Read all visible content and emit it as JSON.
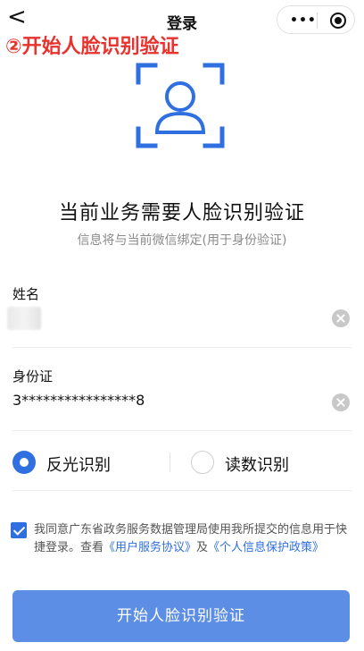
{
  "nav": {
    "back_glyph": "<",
    "title": "登录"
  },
  "annotation": "②开始人脸识别验证",
  "verify": {
    "headline": "当前业务需要人脸识别验证",
    "subline": "信息将与当前微信绑定(用于身份验证)"
  },
  "form": {
    "name_label": "姓名",
    "name_value": "",
    "id_label": "身份证",
    "id_value": "3****************8"
  },
  "modes": {
    "option1": "反光识别",
    "option2": "读数识别",
    "selected": "反光识别"
  },
  "agreement": {
    "text_before": "我同意广东省政务服务数据管理局使用我所提交的信息用于快捷登录。查看",
    "link1": "《用户服务协议》",
    "and": "及",
    "link2": "《个人信息保护政策》"
  },
  "submit_label": "开始人脸识别验证",
  "colors": {
    "accent": "#2f6fe0",
    "button": "#5d8ee6",
    "annotation": "#e8322e"
  }
}
